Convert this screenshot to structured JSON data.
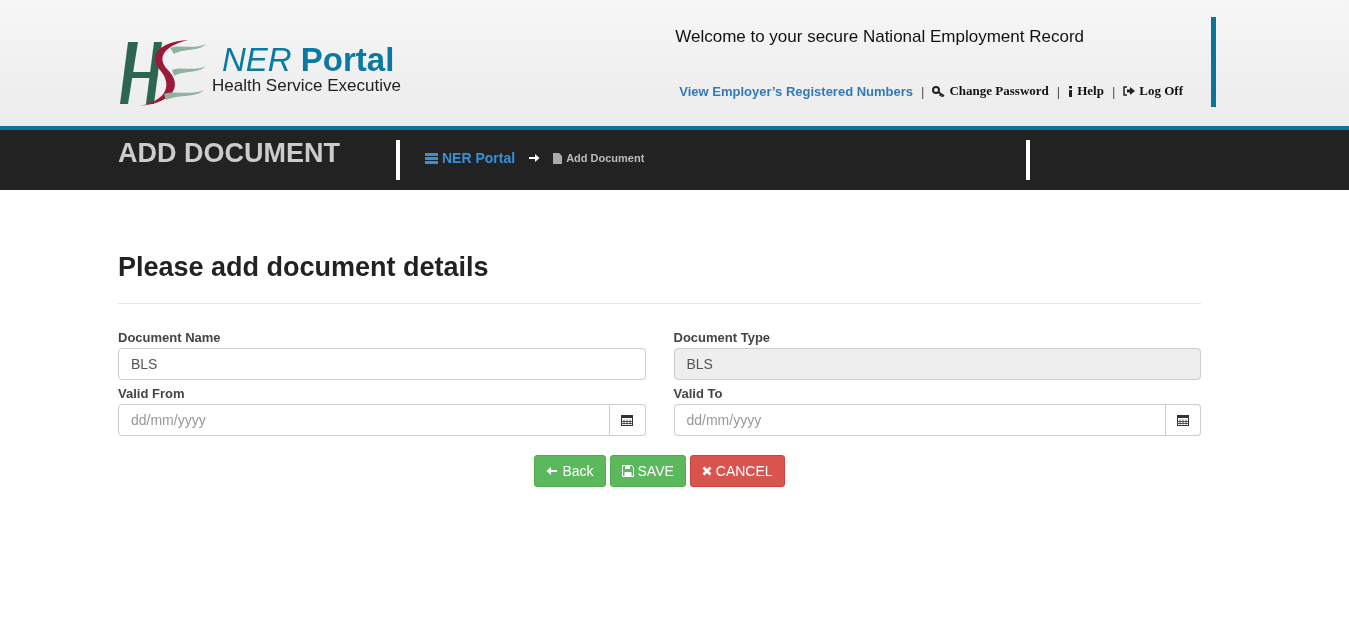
{
  "header": {
    "logo_title_italic": "NER",
    "logo_title_bold": "Portal",
    "logo_subtitle": "Health Service Executive",
    "welcome": "Welcome to your secure National Employment Record",
    "link_separator": "|",
    "links": [
      {
        "kind": "primary",
        "label": "View Employer’s Registered Numbers"
      },
      {
        "kind": "key",
        "label": "Change Password"
      },
      {
        "kind": "info",
        "label": "Help"
      },
      {
        "kind": "logout",
        "label": "Log Off"
      }
    ]
  },
  "page_bar": {
    "title": "ADD DOCUMENT",
    "breadcrumb": [
      {
        "kind": "link",
        "label": "NER Portal"
      },
      {
        "kind": "current",
        "label": "Add Document"
      }
    ]
  },
  "form": {
    "heading": "Please add document details",
    "fields": [
      {
        "kind": "text",
        "label": "Document Name",
        "value": "BLS",
        "disabled": false
      },
      {
        "kind": "text",
        "label": "Document Type",
        "value": "BLS",
        "disabled": true
      },
      {
        "kind": "date",
        "label": "Valid From",
        "placeholder": "dd/mm/yyyy"
      },
      {
        "kind": "date",
        "label": "Valid To",
        "placeholder": "dd/mm/yyyy"
      }
    ],
    "buttons": [
      {
        "kind": "back",
        "label": "Back"
      },
      {
        "kind": "save",
        "label": "SAVE"
      },
      {
        "kind": "cancel",
        "label": "CANCEL"
      }
    ]
  }
}
